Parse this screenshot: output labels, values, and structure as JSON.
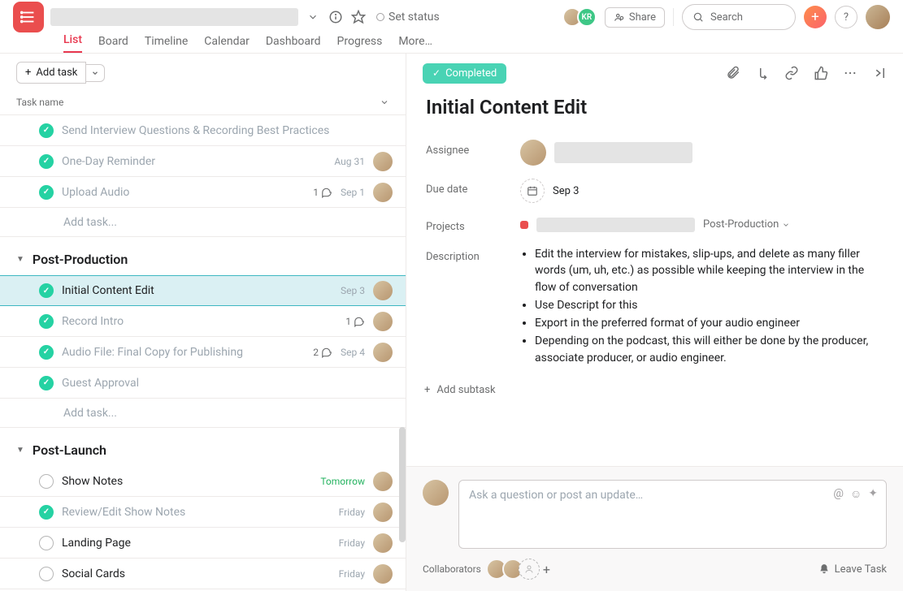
{
  "header": {
    "set_status": "Set status",
    "share": "Share",
    "search_placeholder": "Search",
    "avatars": {
      "kr": "KR"
    },
    "tabs": [
      "List",
      "Board",
      "Timeline",
      "Calendar",
      "Dashboard",
      "Progress",
      "More…"
    ],
    "active_tab": 0
  },
  "list": {
    "add_task": "Add task",
    "col_header": "Task name",
    "add_task_placeholder": "Add task...",
    "sections": [
      {
        "name": "",
        "tasks": [
          {
            "name": "Send Interview Questions & Recording Best Practices",
            "done": true
          },
          {
            "name": "One-Day Reminder",
            "done": true,
            "due": "Aug 31"
          },
          {
            "name": "Upload Audio",
            "done": true,
            "due": "Sep 1",
            "comments": 1
          }
        ]
      },
      {
        "name": "Post-Production",
        "tasks": [
          {
            "name": "Initial Content Edit",
            "done": true,
            "due": "Sep 3",
            "selected": true
          },
          {
            "name": "Record Intro",
            "done": true,
            "comments": 1
          },
          {
            "name": "Audio File: Final Copy for Publishing",
            "done": true,
            "due": "Sep 4",
            "comments": 2
          },
          {
            "name": "Guest Approval",
            "done": true
          }
        ]
      },
      {
        "name": "Post-Launch",
        "tasks": [
          {
            "name": "Show Notes",
            "done": false,
            "due": "Tomorrow",
            "due_color": "tomorrow"
          },
          {
            "name": "Review/Edit Show Notes",
            "done": true,
            "due": "Friday"
          },
          {
            "name": "Landing Page",
            "done": false,
            "due": "Friday"
          },
          {
            "name": "Social Cards",
            "done": false,
            "due": "Friday"
          }
        ]
      }
    ]
  },
  "detail": {
    "completed_label": "Completed",
    "title": "Initial Content Edit",
    "fields": {
      "assignee_label": "Assignee",
      "due_label": "Due date",
      "due_value": "Sep 3",
      "projects_label": "Projects",
      "project_section": "Post-Production",
      "description_label": "Description"
    },
    "description": [
      "Edit the interview for mistakes, slip-ups, and delete as many filler words (um, uh, etc.) as possible while keeping the interview in the flow of conversation",
      "Use Descript for this",
      "Export in the preferred format of your audio engineer",
      "Depending on the podcast, this will either be done by the producer, associate producer, or audio engineer."
    ],
    "add_subtask": "Add subtask",
    "comment_placeholder": "Ask a question or post an update…",
    "collaborators_label": "Collaborators",
    "leave_task": "Leave Task"
  }
}
